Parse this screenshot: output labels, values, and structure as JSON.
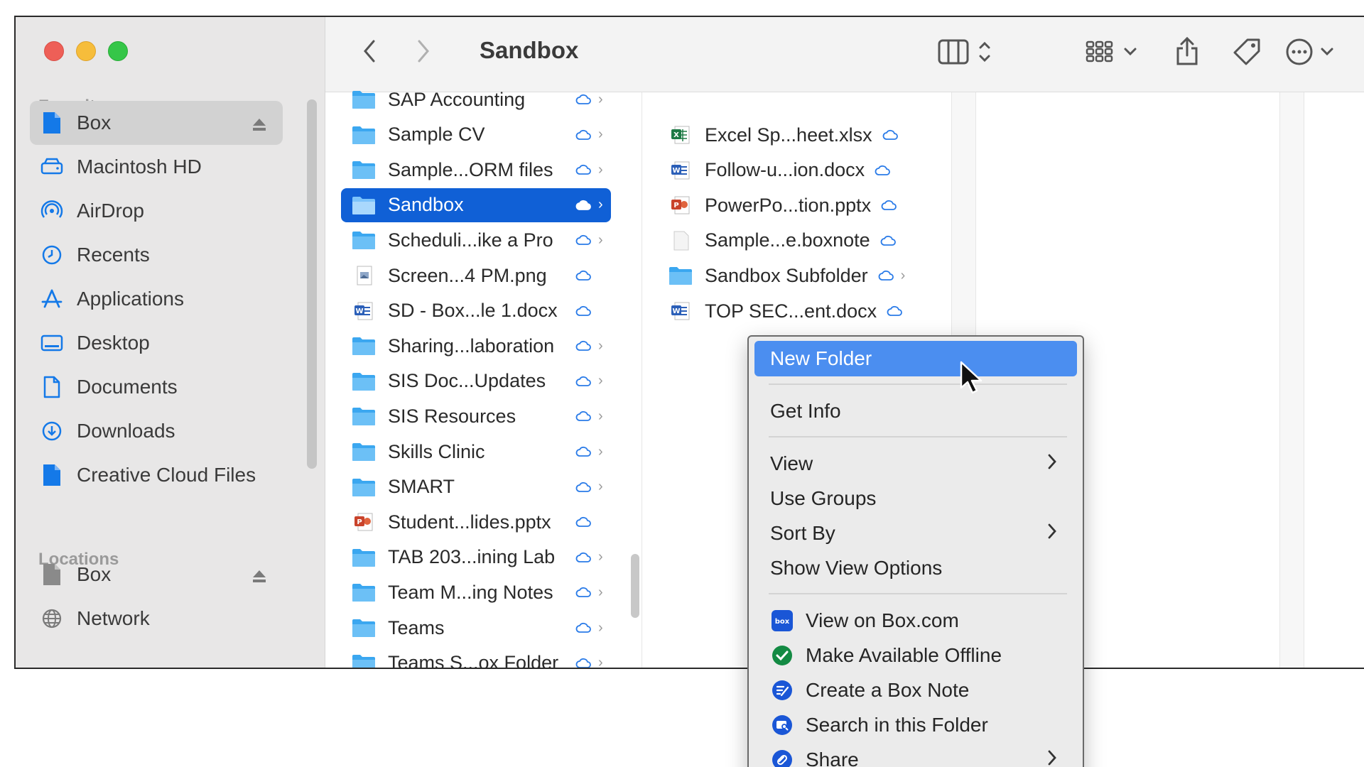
{
  "window": {
    "title": "Sandbox"
  },
  "sidebar": {
    "favorites_label": "Favorites",
    "locations_label": "Locations",
    "favorites": [
      {
        "label": "Box",
        "icon": "box-doc-icon",
        "selected": true,
        "eject": true
      },
      {
        "label": "Macintosh HD",
        "icon": "hard-drive-icon"
      },
      {
        "label": "AirDrop",
        "icon": "airdrop-icon"
      },
      {
        "label": "Recents",
        "icon": "clock-icon"
      },
      {
        "label": "Applications",
        "icon": "applications-icon"
      },
      {
        "label": "Desktop",
        "icon": "desktop-icon"
      },
      {
        "label": "Documents",
        "icon": "document-icon"
      },
      {
        "label": "Downloads",
        "icon": "download-icon"
      },
      {
        "label": "Creative Cloud Files",
        "icon": "creative-cloud-icon"
      }
    ],
    "locations": [
      {
        "label": "Box",
        "icon": "box-doc-icon",
        "eject": true
      },
      {
        "label": "Network",
        "icon": "globe-icon"
      }
    ]
  },
  "column1": [
    {
      "name": "SAP Accounting",
      "type": "folder",
      "folder": true
    },
    {
      "name": "Sample CV",
      "type": "folder",
      "folder": true
    },
    {
      "name": "Sample...ORM files",
      "type": "folder",
      "folder": true
    },
    {
      "name": "Sandbox",
      "type": "folder",
      "folder": true,
      "selected": true
    },
    {
      "name": "Scheduli...ike a Pro",
      "type": "folder",
      "folder": true
    },
    {
      "name": "Screen...4 PM.png",
      "type": "image",
      "folder": false
    },
    {
      "name": "SD - Box...le 1.docx",
      "type": "word",
      "folder": false
    },
    {
      "name": "Sharing...laboration",
      "type": "folder",
      "folder": true
    },
    {
      "name": "SIS Doc...Updates",
      "type": "folder",
      "folder": true
    },
    {
      "name": "SIS Resources",
      "type": "folder",
      "folder": true
    },
    {
      "name": "Skills Clinic",
      "type": "folder",
      "folder": true
    },
    {
      "name": "SMART",
      "type": "folder",
      "folder": true
    },
    {
      "name": "Student...lides.pptx",
      "type": "ppt",
      "folder": false
    },
    {
      "name": "TAB 203...ining Lab",
      "type": "folder",
      "folder": true
    },
    {
      "name": "Team M...ing Notes",
      "type": "folder",
      "folder": true
    },
    {
      "name": "Teams",
      "type": "folder",
      "folder": true
    },
    {
      "name": "Teams S...ox Folder",
      "type": "folder",
      "folder": true
    }
  ],
  "column2": [
    {
      "name": "Excel Sp...heet.xlsx",
      "type": "excel",
      "folder": false
    },
    {
      "name": "Follow-u...ion.docx",
      "type": "word",
      "folder": false
    },
    {
      "name": "PowerPo...tion.pptx",
      "type": "ppt",
      "folder": false
    },
    {
      "name": "Sample...e.boxnote",
      "type": "blank",
      "folder": false
    },
    {
      "name": "Sandbox Subfolder",
      "type": "folder",
      "folder": true
    },
    {
      "name": "TOP SEC...ent.docx",
      "type": "word",
      "folder": false
    }
  ],
  "context_menu": {
    "items": [
      {
        "label": "New Folder",
        "highlighted": true
      },
      {
        "separator": true
      },
      {
        "label": "Get Info"
      },
      {
        "separator": true
      },
      {
        "label": "View",
        "submenu": true
      },
      {
        "label": "Use Groups"
      },
      {
        "label": "Sort By",
        "submenu": true
      },
      {
        "label": "Show View Options"
      },
      {
        "separator": true
      },
      {
        "label": "View on Box.com",
        "icon": "box-logo-icon"
      },
      {
        "label": "Make Available Offline",
        "icon": "checkmark-circle-icon"
      },
      {
        "label": "Create a Box Note",
        "icon": "box-note-icon"
      },
      {
        "label": "Search in this Folder",
        "icon": "folder-search-icon"
      },
      {
        "label": "Share",
        "icon": "link-icon",
        "submenu": true
      }
    ]
  },
  "colors": {
    "selection": "#1060d6",
    "menu_highlight": "#4b8ef0",
    "folder": "#3ba7f0",
    "sidebar_icon": "#1479e8"
  }
}
